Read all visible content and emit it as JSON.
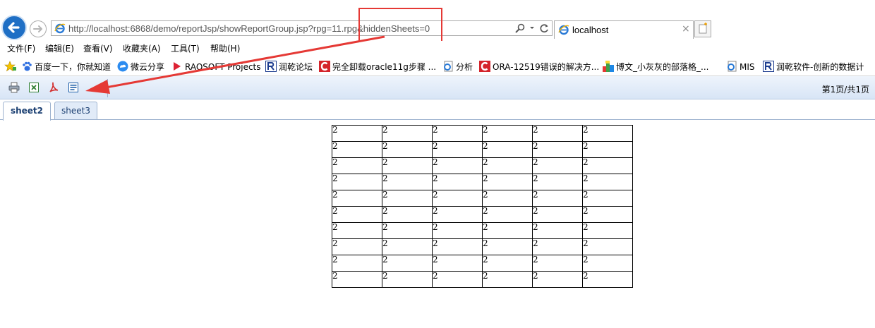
{
  "address_bar": {
    "url": "http://localhost:6868/demo/reportJsp/showReportGroup.jsp?rpg=11.rpg&hiddenSheets=0"
  },
  "browser_tab": {
    "title": "localhost",
    "close": "×"
  },
  "menu": [
    "文件(F)",
    "编辑(E)",
    "查看(V)",
    "收藏夹(A)",
    "工具(T)",
    "帮助(H)"
  ],
  "favorites": [
    {
      "label": "百度一下，你就知道",
      "icon": "baidu-paw-icon"
    },
    {
      "label": "微云分享",
      "icon": "weiyun-cloud-icon"
    },
    {
      "label": "RAQSOFT Projects",
      "icon": "raqsoft-icon"
    },
    {
      "label": "润乾论坛",
      "icon": "runqian-icon"
    },
    {
      "label": "完全卸载oracle11g步骤 ...",
      "icon": "csdn-c-icon"
    },
    {
      "label": "分析",
      "icon": "ie-page-icon"
    },
    {
      "label": "ORA-12519错误的解决方...",
      "icon": "csdn-c-icon"
    },
    {
      "label": "博文_小灰灰的部落格_...",
      "icon": "colorful-blocks-icon"
    },
    {
      "label": "MIS",
      "icon": "ie-page-icon"
    },
    {
      "label": "润乾软件-创新的数据计",
      "icon": "runqian-icon"
    }
  ],
  "toolbar": {
    "tools": [
      "print-icon",
      "excel-export-icon",
      "pdf-export-icon",
      "word-export-icon"
    ],
    "page_info": "第1页/共1页"
  },
  "sheet_tabs": [
    {
      "label": "sheet2",
      "active": true
    },
    {
      "label": "sheet3",
      "active": false
    }
  ],
  "report_table": {
    "rows": [
      [
        "2",
        "2",
        "2",
        "2",
        "2",
        "2"
      ],
      [
        "2",
        "2",
        "2",
        "2",
        "2",
        "2"
      ],
      [
        "2",
        "2",
        "2",
        "2",
        "2",
        "2"
      ],
      [
        "2",
        "2",
        "2",
        "2",
        "2",
        "2"
      ],
      [
        "2",
        "2",
        "2",
        "2",
        "2",
        "2"
      ],
      [
        "2",
        "2",
        "2",
        "2",
        "2",
        "2"
      ],
      [
        "2",
        "2",
        "2",
        "2",
        "2",
        "2"
      ],
      [
        "2",
        "2",
        "2",
        "2",
        "2",
        "2"
      ],
      [
        "2",
        "2",
        "2",
        "2",
        "2",
        "2"
      ],
      [
        "2",
        "2",
        "2",
        "2",
        "2",
        "2"
      ]
    ]
  },
  "colors": {
    "annotation": "#e53935",
    "toolbar_gradient_top": "#eef4fc",
    "toolbar_gradient_bottom": "#d8e5f6",
    "back_button": "#1f6fc5"
  }
}
